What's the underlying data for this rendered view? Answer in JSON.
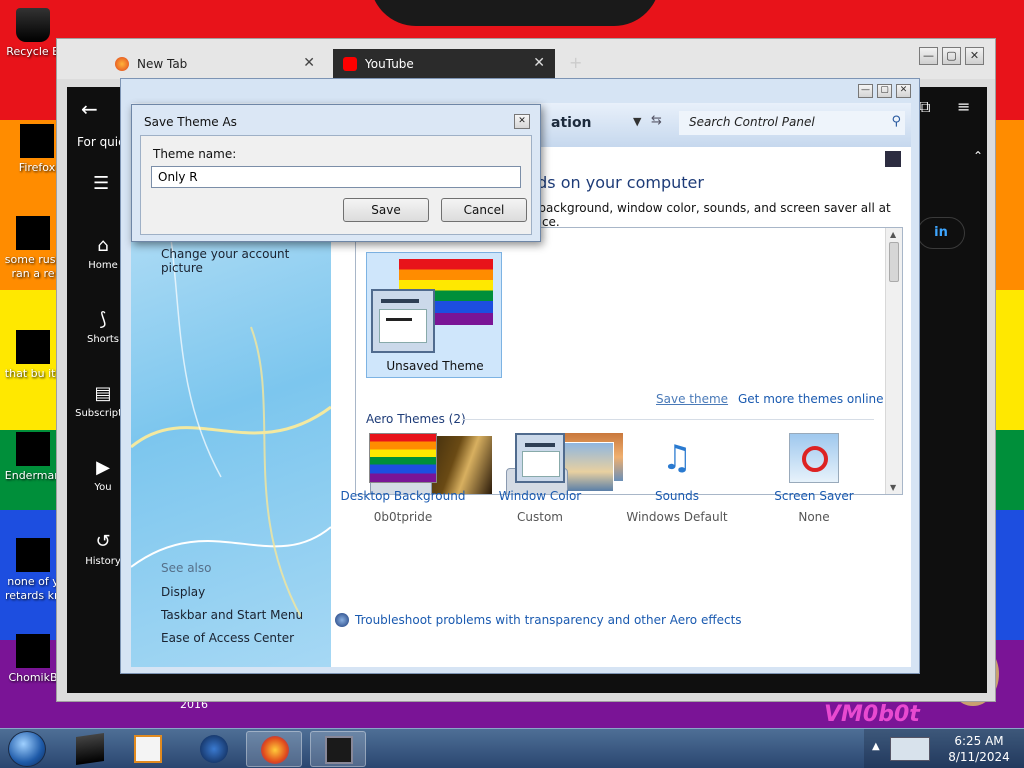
{
  "desktop": {
    "icons": [
      {
        "label": "Recycle B"
      },
      {
        "label": "Firefox"
      },
      {
        "label": "some russ ran a re"
      },
      {
        "label": "that bu its"
      },
      {
        "label": "Enderman"
      },
      {
        "label": "none of y retards kn"
      },
      {
        "label": "ChomikB"
      }
    ],
    "watermark_small": "2016",
    "watermark_brand": "VM0b0t"
  },
  "browser": {
    "tabs": [
      {
        "label": "New Tab",
        "favicon": "firefox-icon"
      },
      {
        "label": "YouTube",
        "favicon": "youtube-icon"
      }
    ],
    "youtube": {
      "quick_text": "For quick",
      "nav": [
        {
          "label": "Home",
          "icon": "home-icon"
        },
        {
          "label": "Shorts",
          "icon": "shorts-icon"
        },
        {
          "label": "Subscriptio",
          "icon": "subscriptions-icon"
        },
        {
          "label": "You",
          "icon": "you-icon"
        },
        {
          "label": "History",
          "icon": "history-icon"
        }
      ],
      "signin_fragment": "in"
    }
  },
  "control_panel": {
    "breadcrumb": "ation",
    "search_placeholder": "Search Control Panel",
    "headline": "nds on your computer",
    "subheadline": "p background, window color, sounds, and screen saver all at once.",
    "left_links": {
      "account_picture": "Change your account picture",
      "see_also": "See also",
      "display": "Display",
      "taskbar": "Taskbar and Start Menu",
      "ease": "Ease of Access Center"
    },
    "unsaved_theme_label": "Unsaved Theme",
    "save_theme_link": "Save theme",
    "get_more_link": "Get more themes online",
    "aero_header": "Aero Themes (2)",
    "options": [
      {
        "label": "Desktop Background",
        "value": "0b0tpride"
      },
      {
        "label": "Window Color",
        "value": "Custom"
      },
      {
        "label": "Sounds",
        "value": "Windows Default"
      },
      {
        "label": "Screen Saver",
        "value": "None"
      }
    ],
    "troubleshoot_link": "Troubleshoot problems with transparency and other Aero effects"
  },
  "dialog": {
    "title": "Save Theme As",
    "field_label": "Theme name:",
    "field_value": "Only R",
    "save_label": "Save",
    "cancel_label": "Cancel"
  },
  "taskbar": {
    "time": "6:25 AM",
    "date": "8/11/2024"
  }
}
